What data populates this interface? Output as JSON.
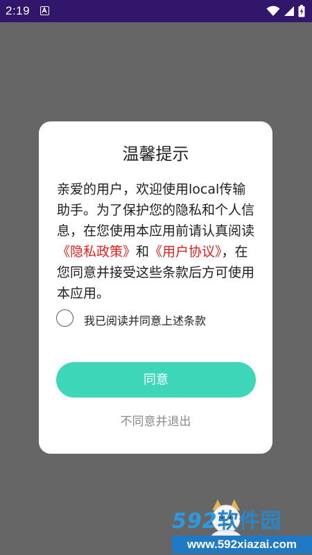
{
  "status_bar": {
    "time": "2:19",
    "notification_icon": "a-icon",
    "wifi_icon": "wifi-icon",
    "signal_icon": "signal-icon",
    "battery_icon": "battery-icon",
    "background_color": "#31166b"
  },
  "dialog": {
    "title": "温馨提示",
    "body": {
      "part1": "亲爱的用户，欢迎使用local传输助手。为了保护您的隐私和个人信息，在您使用本应用前请认真阅读",
      "privacy_link": "《隐私政策》",
      "and": "和",
      "terms_link": "《用户协议》",
      "part2": "，在您同意并接受这些条款后方可使用本应用。"
    },
    "consent_label": "我已阅读并同意上述条款",
    "agree_button": "同意",
    "decline_button": "不同意并退出",
    "colors": {
      "accent": "#3ed6b8",
      "link": "#e0201c",
      "overlay": "#666666"
    }
  },
  "watermark": {
    "brand_number": "592",
    "brand_text": "软件园",
    "url": "www.592xiazai.com"
  }
}
